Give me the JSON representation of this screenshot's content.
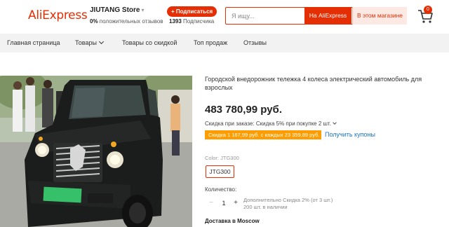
{
  "header": {
    "logo_text": "AliExpress",
    "store_name": "JIUTANG Store",
    "positive_pct": "0%",
    "positive_text": "положительных отзывов",
    "subscribe_label": "+ Подписаться",
    "subscribers_count": "1393",
    "subscribers_text": "Подписчика",
    "search_placeholder": "Я ищу...",
    "search_aliexpress_label": "На AliExpress",
    "search_store_label": "В этом магазине",
    "cart_count": "0",
    "brand_color": "#e62e04"
  },
  "nav": {
    "items": [
      {
        "label": "Главная страница"
      },
      {
        "label": "Товары"
      },
      {
        "label": "Товары со скидкой"
      },
      {
        "label": "Топ продаж"
      },
      {
        "label": "Отзывы"
      }
    ]
  },
  "product": {
    "title": "Городской внедорожник тележка 4 колеса электрический автомобиль для взрослых",
    "price": "483 780,99 руб.",
    "discount_text": "Скидка при заказе: Скидка 5% при покупке 2 шт.",
    "coupon_text": "Скидка 1 167,99 руб. с каждых 23 359,89 руб.",
    "coupon_link": "Получить купоны",
    "color_label": "Color:",
    "color_value": "JTG300",
    "color_option": "JTG300",
    "quantity_label": "Количество:",
    "quantity_value": "1",
    "quantity_minus": "−",
    "quantity_plus": "+",
    "quantity_discount_note": "Дополнительно Скидка 2% (от 3 шт.)",
    "stock_note": "200 шт. в наличии",
    "delivery_text": "Доставка в Moscow",
    "coupon_color": "#ff9d00",
    "link_color": "#1a73c8"
  }
}
